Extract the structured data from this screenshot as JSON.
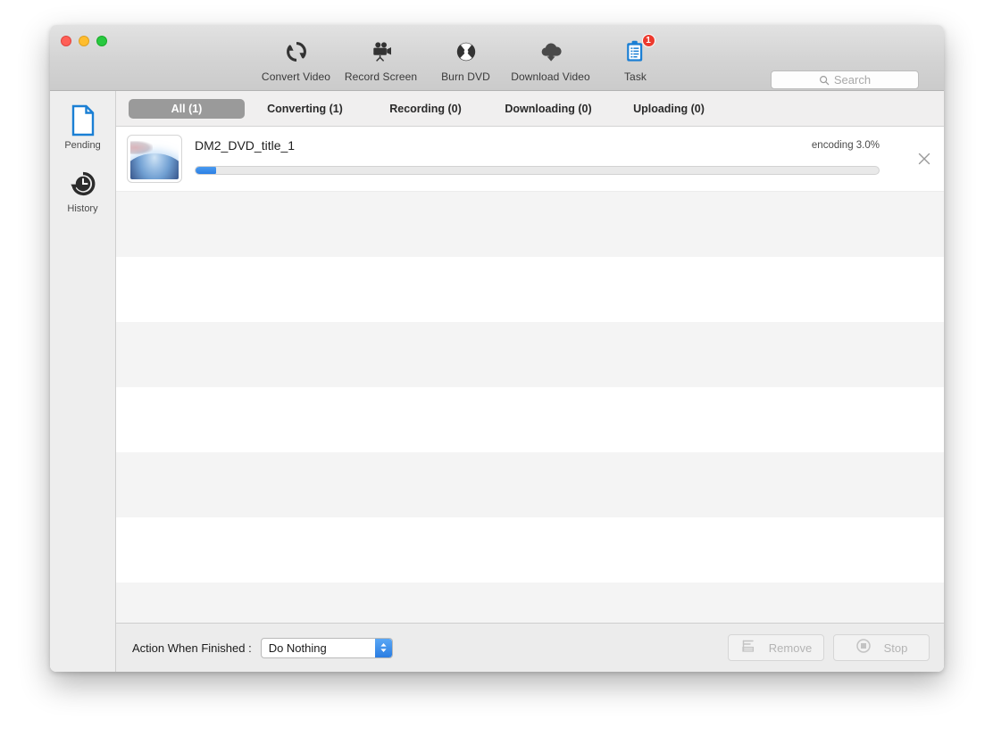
{
  "window": {
    "traffic_lights": [
      "close",
      "minimize",
      "maximize"
    ]
  },
  "toolbar": {
    "items": [
      {
        "label": "Convert Video",
        "icon": "convert-video-icon",
        "active": false
      },
      {
        "label": "Record Screen",
        "icon": "record-screen-icon",
        "active": false
      },
      {
        "label": "Burn DVD",
        "icon": "burn-dvd-icon",
        "active": false
      },
      {
        "label": "Download Video",
        "icon": "download-video-icon",
        "active": false
      },
      {
        "label": "Task",
        "icon": "task-icon",
        "active": true,
        "badge": "1"
      }
    ],
    "accent_color": "#1a7fd4",
    "badge_color": "#ec3a2e"
  },
  "search": {
    "icon": "search-icon",
    "placeholder": "Search",
    "value": ""
  },
  "sidebar": {
    "items": [
      {
        "label": "Pending",
        "icon": "document-icon",
        "active": true
      },
      {
        "label": "History",
        "icon": "clock-history-icon",
        "active": false
      }
    ]
  },
  "tabs": [
    {
      "label": "All (1)",
      "active": true
    },
    {
      "label": "Converting (1)",
      "active": false
    },
    {
      "label": "Recording (0)",
      "active": false
    },
    {
      "label": "Downloading (0)",
      "active": false
    },
    {
      "label": "Uploading (0)",
      "active": false
    }
  ],
  "task": {
    "title": "DM2_DVD_title_1",
    "status": "encoding 3.0%",
    "progress_percent": 3.0,
    "progress_color": "#2b7fe4",
    "thumbnail": "earth-from-space-thumbnail",
    "close_icon": "close-icon"
  },
  "empty_rows": 8,
  "footer": {
    "action_label": "Action When Finished :",
    "action_select": {
      "value": "Do Nothing",
      "options": [
        "Do Nothing"
      ],
      "stepper_icon": "stepper-updown-icon"
    },
    "remove_button": {
      "label": "Remove",
      "icon": "remove-list-icon",
      "disabled": true
    },
    "stop_button": {
      "label": "Stop",
      "icon": "stop-circle-icon",
      "disabled": true
    }
  }
}
